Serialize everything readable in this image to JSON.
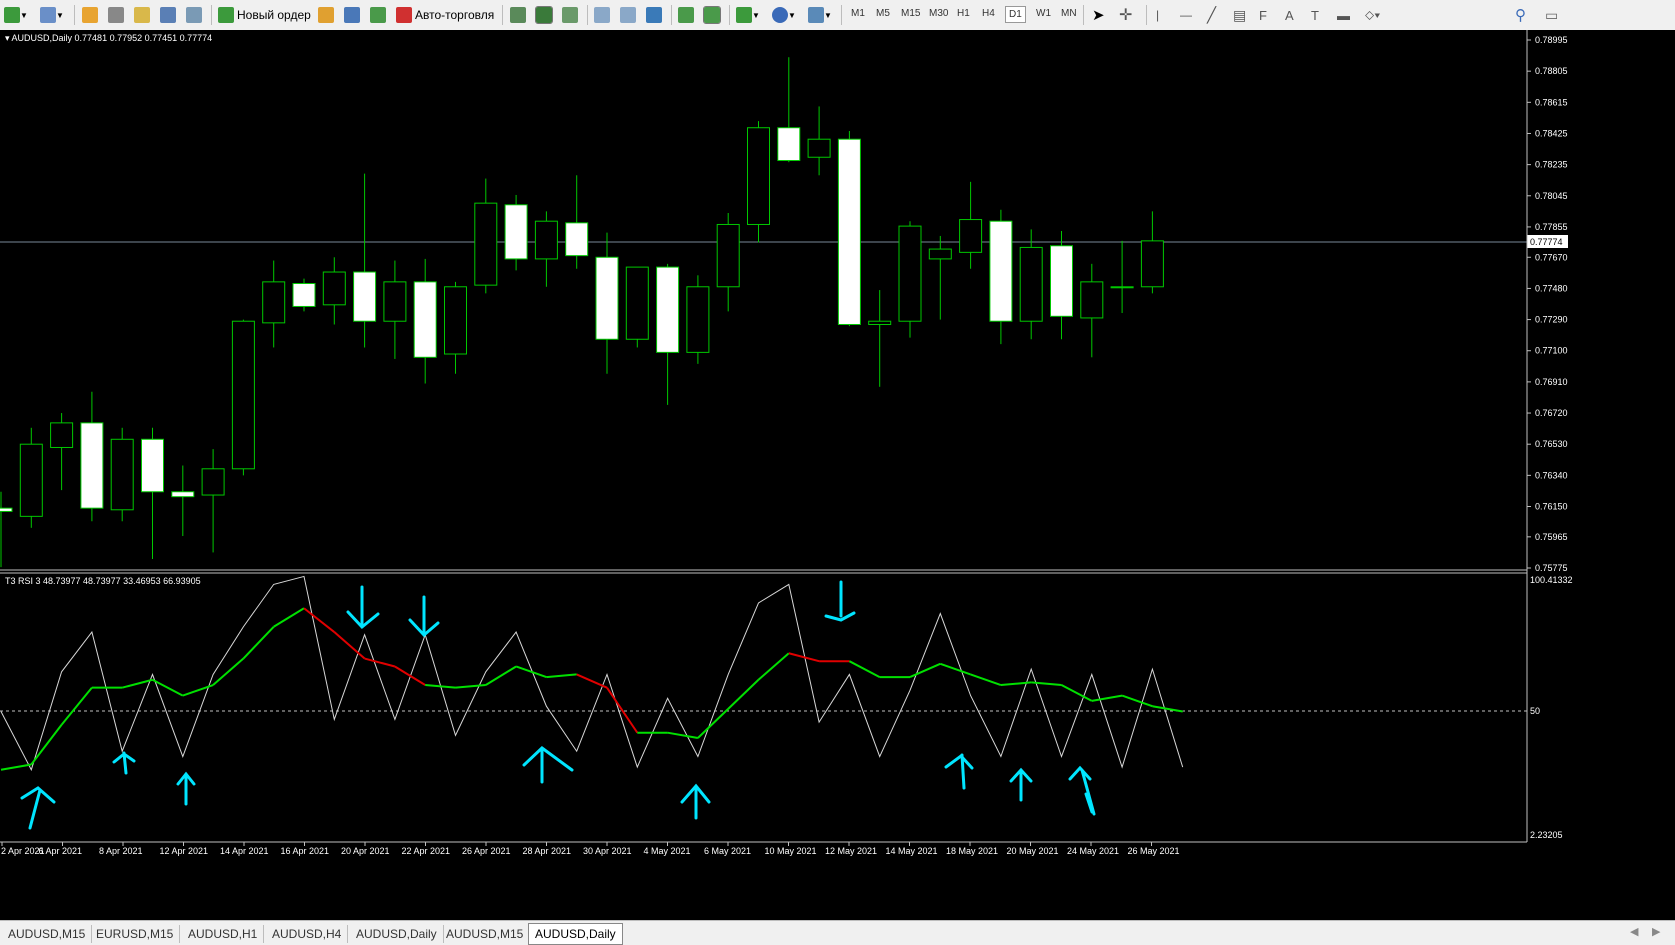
{
  "toolbar": {
    "new_order_label": "Новый ордер",
    "auto_trading_label": "Авто-торговля",
    "timeframes": [
      "M1",
      "M5",
      "M15",
      "M30",
      "H1",
      "H4",
      "D1",
      "W1",
      "MN"
    ],
    "active_timeframe": "D1"
  },
  "main_chart": {
    "header": "AUDUSD,Daily  0.77481 0.77952 0.77451 0.77774",
    "current_price_label": "0.77774",
    "price_axis_labels": [
      "0.78995",
      "0.78805",
      "0.78615",
      "0.78425",
      "0.78235",
      "0.78045",
      "0.77855",
      "0.77670",
      "0.77480",
      "0.77290",
      "0.77100",
      "0.76910",
      "0.76720",
      "0.76530",
      "0.76340",
      "0.76150",
      "0.75965",
      "0.75775"
    ]
  },
  "indicator": {
    "header": "T3 RSI 3  48.73977 48.73977 33.46953 66.93905",
    "axis_top": "100.41332",
    "axis_mid": "50",
    "axis_bottom": "2.23205"
  },
  "date_axis_labels": [
    "2 Apr 2021",
    "6 Apr 2021",
    "8 Apr 2021",
    "12 Apr 2021",
    "14 Apr 2021",
    "16 Apr 2021",
    "20 Apr 2021",
    "22 Apr 2021",
    "26 Apr 2021",
    "28 Apr 2021",
    "30 Apr 2021",
    "4 May 2021",
    "6 May 2021",
    "10 May 2021",
    "12 May 2021",
    "14 May 2021",
    "18 May 2021",
    "20 May 2021",
    "24 May 2021",
    "26 May 2021"
  ],
  "tabs": [
    "AUDUSD,M15",
    "EURUSD,M15",
    "AUDUSD,H1",
    "AUDUSD,H4",
    "AUDUSD,Daily",
    "AUDUSD,M15",
    "AUDUSD,Daily"
  ],
  "active_tab_index": 6,
  "chart_data": {
    "type": "candlestick",
    "symbol": "AUDUSD",
    "timeframe": "Daily",
    "ylim": [
      0.75775,
      0.78995
    ],
    "candles": [
      {
        "o": 0.7614,
        "h": 0.7624,
        "l": 0.7578,
        "c": 0.7612
      },
      {
        "o": 0.7609,
        "h": 0.7663,
        "l": 0.7602,
        "c": 0.7653
      },
      {
        "o": 0.7651,
        "h": 0.7672,
        "l": 0.7625,
        "c": 0.7666
      },
      {
        "o": 0.7666,
        "h": 0.7685,
        "l": 0.7606,
        "c": 0.7614
      },
      {
        "o": 0.7613,
        "h": 0.7663,
        "l": 0.7606,
        "c": 0.7656
      },
      {
        "o": 0.7656,
        "h": 0.7663,
        "l": 0.7583,
        "c": 0.7624
      },
      {
        "o": 0.7624,
        "h": 0.764,
        "l": 0.7597,
        "c": 0.7621
      },
      {
        "o": 0.7622,
        "h": 0.765,
        "l": 0.7587,
        "c": 0.7638
      },
      {
        "o": 0.7638,
        "h": 0.7729,
        "l": 0.7634,
        "c": 0.7728
      },
      {
        "o": 0.7727,
        "h": 0.7765,
        "l": 0.7712,
        "c": 0.7752
      },
      {
        "o": 0.7751,
        "h": 0.7754,
        "l": 0.7734,
        "c": 0.7737
      },
      {
        "o": 0.7738,
        "h": 0.7767,
        "l": 0.7726,
        "c": 0.7758
      },
      {
        "o": 0.7758,
        "h": 0.7818,
        "l": 0.7712,
        "c": 0.7728
      },
      {
        "o": 0.7728,
        "h": 0.7765,
        "l": 0.7705,
        "c": 0.7752
      },
      {
        "o": 0.7752,
        "h": 0.7766,
        "l": 0.769,
        "c": 0.7706
      },
      {
        "o": 0.7708,
        "h": 0.7752,
        "l": 0.7696,
        "c": 0.7749
      },
      {
        "o": 0.775,
        "h": 0.7815,
        "l": 0.7745,
        "c": 0.78
      },
      {
        "o": 0.7799,
        "h": 0.7805,
        "l": 0.7759,
        "c": 0.7766
      },
      {
        "o": 0.7766,
        "h": 0.7795,
        "l": 0.7749,
        "c": 0.7789
      },
      {
        "o": 0.7788,
        "h": 0.7817,
        "l": 0.776,
        "c": 0.7768
      },
      {
        "o": 0.7767,
        "h": 0.7782,
        "l": 0.7696,
        "c": 0.7717
      },
      {
        "o": 0.7717,
        "h": 0.776,
        "l": 0.7712,
        "c": 0.7761
      },
      {
        "o": 0.7761,
        "h": 0.7763,
        "l": 0.7677,
        "c": 0.7709
      },
      {
        "o": 0.7709,
        "h": 0.7756,
        "l": 0.7702,
        "c": 0.7749
      },
      {
        "o": 0.7749,
        "h": 0.7794,
        "l": 0.7734,
        "c": 0.7787
      },
      {
        "o": 0.7787,
        "h": 0.785,
        "l": 0.7776,
        "c": 0.7846
      },
      {
        "o": 0.7846,
        "h": 0.7889,
        "l": 0.7825,
        "c": 0.7826
      },
      {
        "o": 0.7828,
        "h": 0.7859,
        "l": 0.7817,
        "c": 0.7839
      },
      {
        "o": 0.7839,
        "h": 0.7844,
        "l": 0.7725,
        "c": 0.7726
      },
      {
        "o": 0.7726,
        "h": 0.7747,
        "l": 0.7688,
        "c": 0.7728
      },
      {
        "o": 0.7728,
        "h": 0.7789,
        "l": 0.7718,
        "c": 0.7786
      },
      {
        "o": 0.7766,
        "h": 0.778,
        "l": 0.7729,
        "c": 0.7772
      },
      {
        "o": 0.777,
        "h": 0.7813,
        "l": 0.776,
        "c": 0.779
      },
      {
        "o": 0.7789,
        "h": 0.7796,
        "l": 0.7714,
        "c": 0.7728
      },
      {
        "o": 0.7728,
        "h": 0.7784,
        "l": 0.7717,
        "c": 0.7773
      },
      {
        "o": 0.7774,
        "h": 0.7783,
        "l": 0.7717,
        "c": 0.7731
      },
      {
        "o": 0.773,
        "h": 0.7763,
        "l": 0.7706,
        "c": 0.7752
      },
      {
        "o": 0.7749,
        "h": 0.7777,
        "l": 0.7733,
        "c": 0.7749
      },
      {
        "o": 0.7749,
        "h": 0.7795,
        "l": 0.7745,
        "c": 0.7777
      }
    ],
    "rsi_ylim": [
      2.23205,
      100.41332
    ],
    "rsi_level": 50,
    "rsi_fast": [
      50,
      28,
      65,
      80,
      35,
      64,
      33,
      64,
      82,
      98,
      101,
      47,
      79,
      47,
      79,
      41,
      65,
      80,
      52,
      35,
      64,
      29,
      55,
      33,
      64,
      91,
      98,
      46,
      64,
      33,
      58,
      87,
      56,
      33,
      66,
      33,
      64,
      29,
      66,
      29
    ],
    "rsi_slow": [
      28,
      30,
      45,
      59,
      59,
      62,
      56,
      60,
      70,
      82,
      89,
      80,
      70,
      67,
      60,
      59,
      60,
      67,
      63,
      64,
      59,
      42,
      42,
      40,
      51,
      62,
      72,
      69,
      69,
      63,
      63,
      68,
      64,
      60,
      61,
      60,
      54,
      56,
      52,
      50
    ],
    "rsi_slow_color": [
      "g",
      "g",
      "g",
      "g",
      "g",
      "g",
      "g",
      "g",
      "g",
      "g",
      "g",
      "r",
      "r",
      "r",
      "r",
      "g",
      "g",
      "g",
      "g",
      "g",
      "r",
      "r",
      "g",
      "g",
      "g",
      "g",
      "g",
      "r",
      "r",
      "g",
      "g",
      "g",
      "g",
      "g",
      "g",
      "g",
      "g",
      "g",
      "g",
      "g"
    ]
  }
}
